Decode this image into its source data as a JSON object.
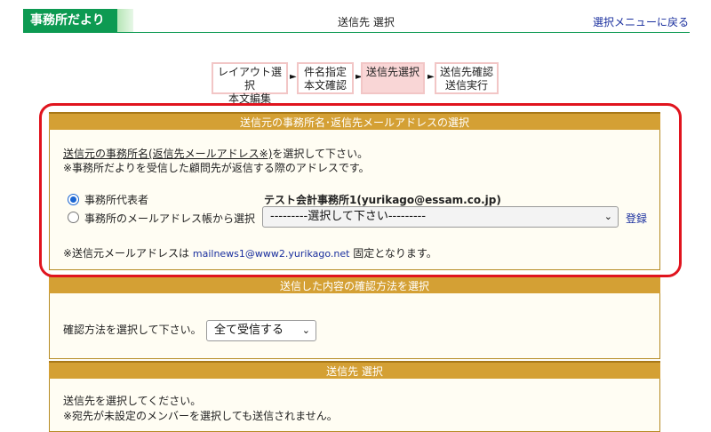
{
  "header": {
    "brand": "事務所だより",
    "title": "送信先 選択",
    "back_link": "選択メニューに戻る"
  },
  "steps": [
    {
      "label": "レイアウト選択\n本文編集",
      "active": false
    },
    {
      "label": "件名指定\n本文確認",
      "active": false
    },
    {
      "label": "送信先選択",
      "active": true
    },
    {
      "label": "送信先確認\n送信実行",
      "active": false
    }
  ],
  "sender_section": {
    "heading": "送信元の事務所名･返信先メールアドレスの選択",
    "instruction_underlined": "送信元の事務所名(返信先メールアドレス※)",
    "instruction_rest": "を選択して下さい。",
    "note": "※事務所だよりを受信した顧問先が返信する際のアドレスです。",
    "radio_options": [
      {
        "label": "事務所代表者",
        "checked": true
      },
      {
        "label": "事務所のメールアドレス帳から選択",
        "checked": false
      }
    ],
    "representative_value": "テスト会計事務所1(yurikago@essam.co.jp)",
    "address_select": "---------選択して下さい---------",
    "register_link": "登録",
    "fixed_note_prefix": "※送信元メールアドレスは ",
    "fixed_email": "mailnews1@www2.yurikago.net",
    "fixed_note_suffix": " 固定となります。"
  },
  "confirm_section": {
    "heading": "送信した内容の確認方法を選択",
    "prompt": "確認方法を選択して下さい。",
    "select_value": "全て受信する"
  },
  "recipient_section": {
    "heading": "送信先 選択",
    "line1": "送信先を選択してください。",
    "line2": "※宛先が未設定のメンバーを選択しても送信されません。"
  },
  "colors": {
    "brand_green": "#0d9a52",
    "section_gold": "#d4a034",
    "active_step": "#f9d6d6",
    "highlight_red": "#e0141e",
    "link_blue": "#1a2f9e"
  }
}
